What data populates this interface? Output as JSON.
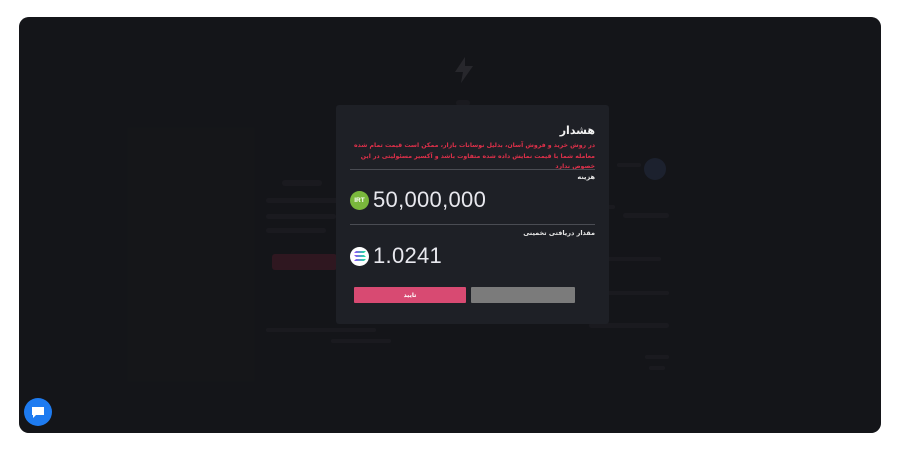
{
  "modal": {
    "title": "هشدار",
    "warning": "در روش خرید و فروش آسان، بدلیل نوسانات بازار، ممکن است قیمت تمام شده معامله شما با قیمت نمایش داده شده متفاوت باشد و آکسیر مسئولیتی در این خصوص ندارد",
    "cost_label": "هزینه",
    "cost_currency": "IRT",
    "cost_value": "50,000,000",
    "receive_label": "مقدار دریافتی تخمینی",
    "receive_currency_icon": "solana-icon",
    "receive_value": "1.0241",
    "confirm_label": "تایید",
    "cancel_label": ""
  },
  "colors": {
    "confirm": "#d84a72",
    "cancel": "#7b7b7b",
    "warning_text": "#e0304a",
    "irt_coin": "#7ab83c",
    "chat": "#1e7bf0"
  },
  "chat": {
    "icon": "chat-icon"
  }
}
